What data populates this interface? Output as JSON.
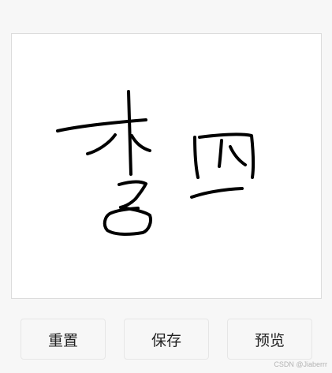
{
  "signature_pad": {
    "stroke_color": "#000000",
    "background_color": "#ffffff",
    "border_color": "#dcdcdc"
  },
  "buttons": {
    "reset_label": "重置",
    "save_label": "保存",
    "preview_label": "预览"
  },
  "watermark": {
    "text": "CSDN @Jiaberrr"
  },
  "colors": {
    "page_background": "#f7f7f7",
    "button_background": "#f7f7f7",
    "button_border": "#e6e6e6",
    "button_text": "#222222"
  }
}
